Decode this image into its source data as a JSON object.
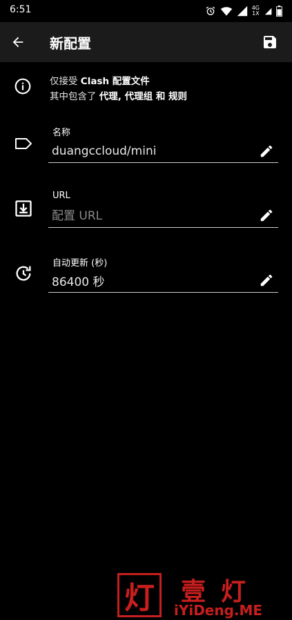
{
  "status_bar": {
    "time": "6:51",
    "network_top": "4G",
    "network_bottom": "1X"
  },
  "app_bar": {
    "title": "新配置"
  },
  "info": {
    "line1_prefix": "仅接受 ",
    "line1_bold": "Clash 配置文件",
    "line2_prefix": "其中包含了 ",
    "line2_bold": "代理, 代理组 和 规则"
  },
  "fields": {
    "name": {
      "label": "名称",
      "value": "duangccloud/mini",
      "placeholder": ""
    },
    "url": {
      "label": "URL",
      "value": "",
      "placeholder": "配置 URL"
    },
    "auto_update": {
      "label": "自动更新 (秒)",
      "value": "86400 秒",
      "placeholder": ""
    }
  },
  "icons": {
    "back": "arrow-left-icon",
    "save": "save-icon",
    "info": "info-icon",
    "label": "label-tag-icon",
    "download": "download-icon",
    "update": "update-clock-icon",
    "edit": "pencil-icon"
  },
  "watermark": {
    "box_char": "灯",
    "chars": "壹灯",
    "url": "iYiDeng.ME",
    "color": "#c81e1e"
  },
  "colors": {
    "background": "#000000",
    "app_bar": "#1b1b1b",
    "text": "#ffffff",
    "placeholder": "#8a8a8a"
  }
}
